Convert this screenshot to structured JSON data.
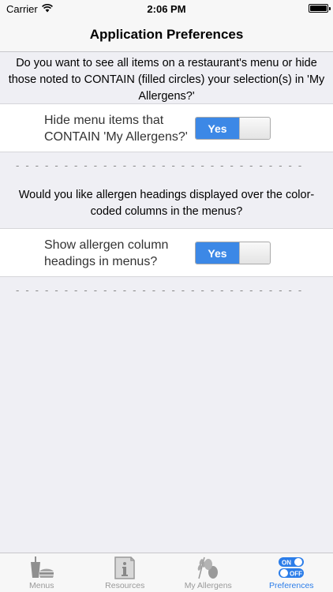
{
  "status_bar": {
    "carrier": "Carrier",
    "time": "2:06 PM",
    "wifi_icon": "wifi-icon",
    "battery_icon": "battery-icon"
  },
  "nav": {
    "title": "Application Preferences"
  },
  "section1": {
    "question": "Do you want to see all items on a restaurant's menu or hide those noted to CONTAIN (filled circles) your selection(s) in 'My Allergens?'",
    "label": "Hide menu items that CONTAIN 'My Allergens?'",
    "toggle_label": "Yes",
    "toggle_on": true,
    "divider": "- - - - - - - - - - - - - - - - - - - - - - - - - - - - - -"
  },
  "section2": {
    "question": "Would you like allergen headings displayed over the color-coded columns in the menus?",
    "label": "Show allergen column headings in menus?",
    "toggle_label": "Yes",
    "toggle_on": true,
    "divider": "- - - - - - - - - - - - - - - - - - - - - - - - - - - - - -"
  },
  "tabs": [
    {
      "label": "Menus",
      "icon": "menus-icon",
      "active": false
    },
    {
      "label": "Resources",
      "icon": "resources-icon",
      "active": false
    },
    {
      "label": "My Allergens",
      "icon": "allergens-icon",
      "active": false
    },
    {
      "label": "Preferences",
      "icon": "preferences-icon",
      "active": true
    }
  ],
  "preferences_icon_text": {
    "on": "ON",
    "off": "OFF"
  },
  "colors": {
    "accent": "#2b7de9",
    "toggle_on": "#3c88e6",
    "background": "#efeff4"
  }
}
